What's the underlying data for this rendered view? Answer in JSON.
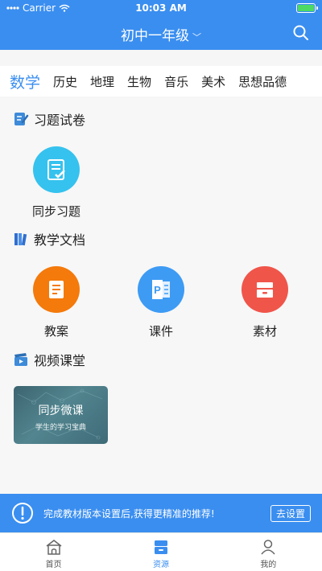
{
  "status_bar": {
    "carrier": "Carrier",
    "time": "10:03 AM"
  },
  "header": {
    "title": "初中一年级",
    "search_icon": "search-icon"
  },
  "tabs": [
    {
      "label": "数学",
      "active": true
    },
    {
      "label": "历史"
    },
    {
      "label": "地理"
    },
    {
      "label": "生物"
    },
    {
      "label": "音乐"
    },
    {
      "label": "美术"
    },
    {
      "label": "思想品德"
    }
  ],
  "sections": {
    "exercises": {
      "title": "习题试卷",
      "items": [
        {
          "label": "同步习题",
          "icon": "checklist-icon",
          "color": "#36c2ee"
        }
      ]
    },
    "documents": {
      "title": "教学文档",
      "items": [
        {
          "label": "教案",
          "icon": "lesson-plan-icon",
          "color": "#f47a0b"
        },
        {
          "label": "课件",
          "icon": "powerpoint-icon",
          "color": "#3d9bf4"
        },
        {
          "label": "素材",
          "icon": "archive-icon",
          "color": "#f0554a"
        }
      ]
    },
    "video": {
      "title": "视频课堂",
      "card": {
        "title": "同步微课",
        "subtitle": "学生的学习宝典"
      }
    }
  },
  "notice": {
    "text": "完成教材版本设置后,获得更精准的推荐!",
    "button": "去设置"
  },
  "bottom_nav": [
    {
      "label": "首页",
      "icon": "home-icon"
    },
    {
      "label": "资源",
      "icon": "resources-icon",
      "active": true
    },
    {
      "label": "我的",
      "icon": "user-icon"
    }
  ],
  "colors": {
    "primary": "#3a8ef0"
  }
}
